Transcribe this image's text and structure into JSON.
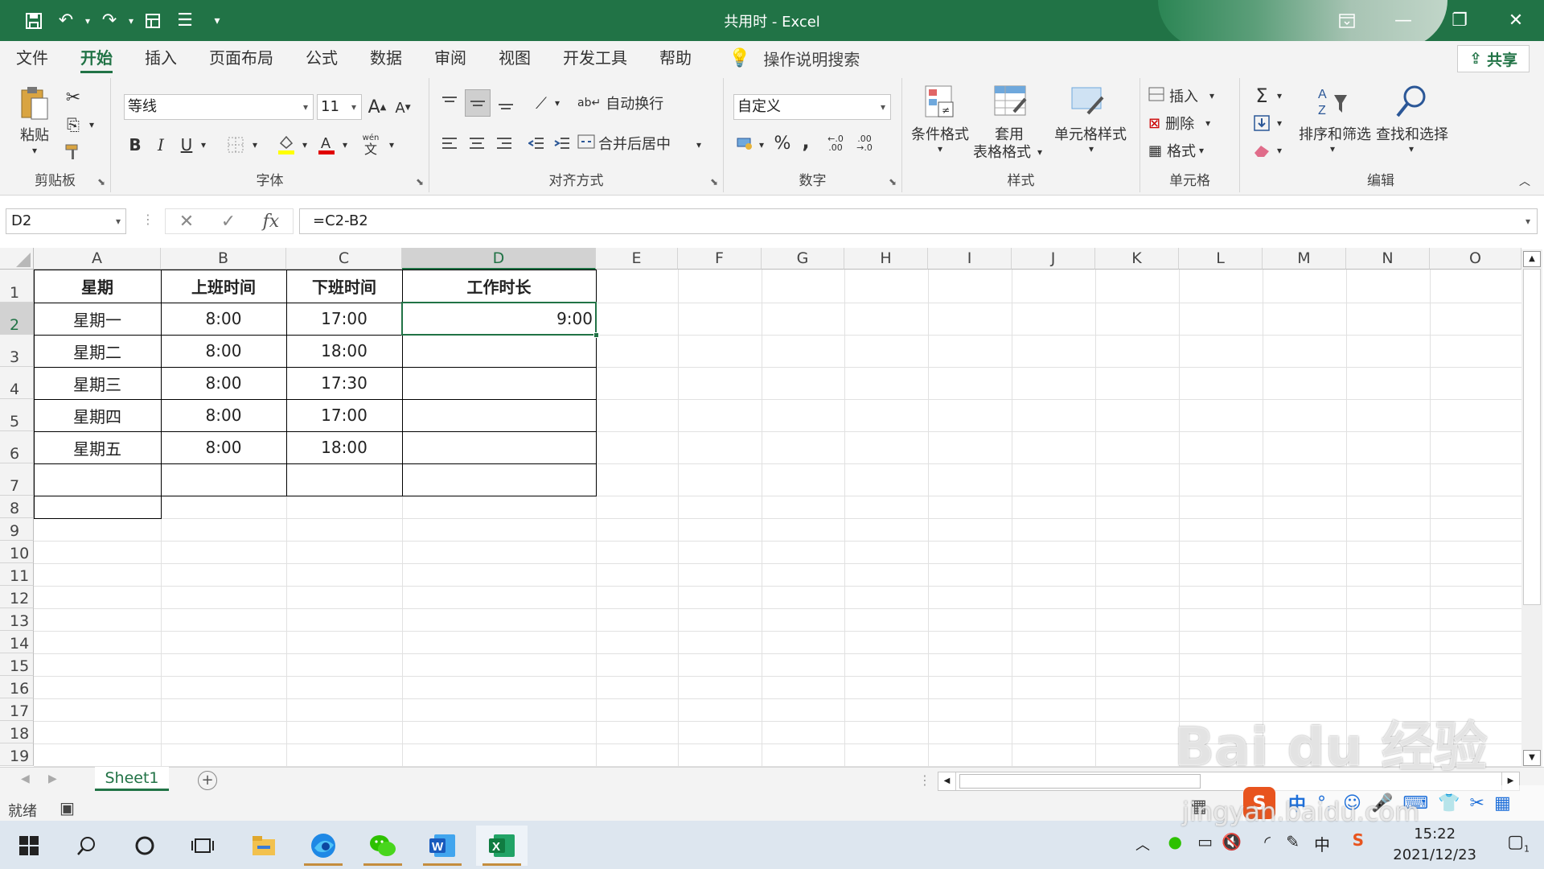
{
  "window": {
    "title": "共用时  -  Excel"
  },
  "ribbon_tabs": [
    "文件",
    "开始",
    "插入",
    "页面布局",
    "公式",
    "数据",
    "审阅",
    "视图",
    "开发工具",
    "帮助"
  ],
  "active_tab": "开始",
  "tell_me": "操作说明搜索",
  "share_label": "共享",
  "clipboard": {
    "paste": "粘贴",
    "group": "剪贴板"
  },
  "font": {
    "name": "等线",
    "size": "11",
    "group": "字体",
    "bold": "B",
    "italic": "I",
    "underline": "U",
    "grow": "A",
    "shrink": "A",
    "phonetic": "文",
    "phonetic_top": "wén"
  },
  "alignment": {
    "wrap": "自动换行",
    "merge": "合并后居中",
    "group": "对齐方式"
  },
  "number": {
    "format": "自定义",
    "percent": "%",
    "comma": ",",
    "group": "数字"
  },
  "styles": {
    "conditional": "条件格式",
    "table_format_1": "套用",
    "table_format_2": "表格格式",
    "cell_styles": "单元格样式",
    "group": "样式"
  },
  "cells": {
    "insert": "插入",
    "delete": "删除",
    "format": "格式",
    "group": "单元格"
  },
  "editing": {
    "sum": "Σ",
    "sort": "排序和筛选",
    "find": "查找和选择",
    "group": "编辑"
  },
  "formula_bar": {
    "name_box": "D2",
    "formula": "=C2-B2",
    "fx": "fx"
  },
  "columns": [
    "A",
    "B",
    "C",
    "D",
    "E",
    "F",
    "G",
    "H",
    "I",
    "J",
    "K",
    "L",
    "M",
    "N",
    "O"
  ],
  "rows": [
    "1",
    "2",
    "3",
    "4",
    "5",
    "6",
    "7",
    "8",
    "9",
    "10",
    "11",
    "12",
    "13",
    "14",
    "15",
    "16",
    "17",
    "18",
    "19"
  ],
  "table": {
    "header": [
      "星期",
      "上班时间",
      "下班时间",
      "工作时长"
    ],
    "rows": [
      [
        "星期一",
        "8:00",
        "17:00",
        "9:00"
      ],
      [
        "星期二",
        "8:00",
        "18:00",
        ""
      ],
      [
        "星期三",
        "8:00",
        "17:30",
        ""
      ],
      [
        "星期四",
        "8:00",
        "17:00",
        ""
      ],
      [
        "星期五",
        "8:00",
        "18:00",
        ""
      ]
    ]
  },
  "sheet_tabs": [
    "Sheet1"
  ],
  "status": {
    "ready": "就绪"
  },
  "taskbar": {
    "time": "15:22",
    "date": "2021/12/23",
    "ime": "中",
    "ime2": "中",
    "notifications": "1"
  },
  "watermark": {
    "text": "Bai du 经验",
    "url": "jingyan.baidu.com"
  },
  "colors": {
    "accent": "#217346",
    "ribbon_bg": "#f3f3f3",
    "grid": "#e1e1e1"
  }
}
